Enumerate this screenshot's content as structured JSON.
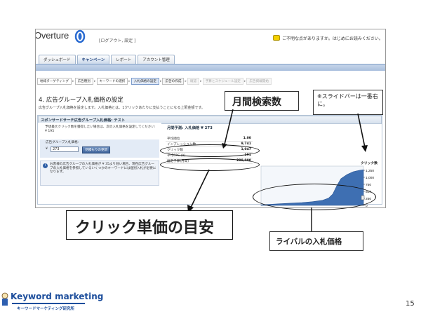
{
  "header": {
    "logo_text": "Overture",
    "sub_links": "[ログアウト, 設定 ]",
    "help_text": "ご不明な点がありますか。はじめにお読みください。"
  },
  "tabs": [
    {
      "label": "ダッシュボード",
      "active": false
    },
    {
      "label": "キャンペーン",
      "active": true
    },
    {
      "label": "レポート",
      "active": false
    },
    {
      "label": "アカウント管理",
      "active": false
    }
  ],
  "steps": [
    {
      "label": "地域ターゲティング",
      "state": "done"
    },
    {
      "label": "広告種別",
      "state": "done"
    },
    {
      "label": "キーワードの選択",
      "state": "done"
    },
    {
      "label": "入札価格の設定",
      "state": "current"
    },
    {
      "label": "広告の作成",
      "state": "todo"
    },
    {
      "label": "確認",
      "state": "dim"
    },
    {
      "label": "予算とスケジュール設定",
      "state": "dim"
    },
    {
      "label": "広告掲載開始",
      "state": "dim"
    }
  ],
  "section": {
    "title": "4. 広告グループ入札価格の設定",
    "description": "広告グループ入札価格を設定します。入札価格とは、1クリックあたりに支払うことになる上限金額です。"
  },
  "panel": {
    "header": "スポンサードサーチ広告グループ入札価格: テスト",
    "recommend_text": "予想最大クリック数を獲得したい場合は、次の入札価格を設定してください: ¥ 195",
    "bid_label": "広告グループ入札価格:",
    "bid_currency": "¥",
    "bid_value": "273",
    "update_button": "見積もりの更新",
    "info_text": "お客様の広告グループの入札価格が ¥ 35より低い場合、現在広告グループの入札価格を参照しているいくつかのキーワードには個別入札が必要になります。"
  },
  "estimate": {
    "heading": "月間予測: 入札価格 ¥ 273",
    "rows": [
      {
        "label": "平均順位",
        "value": "1.00"
      },
      {
        "label": "インプレッション数",
        "value": "9,741"
      },
      {
        "label": "クリック数",
        "value": "1,047"
      },
      {
        "label": "平均CPC (¥)",
        "value": "191"
      },
      {
        "label": "推定予算(月間)",
        "value": "200,000"
      }
    ]
  },
  "chart_data": {
    "type": "area",
    "title": "",
    "xlabel": "入札価格",
    "ylabel": "クリック数",
    "x_ticks": [
      50,
      100,
      150,
      200,
      250
    ],
    "y_ticks": [
      0,
      250,
      500,
      750,
      1000,
      1250
    ],
    "y_tick_labels": [
      "0",
      "250",
      "500",
      "750",
      "1,000",
      "1,250"
    ],
    "xlim": [
      25,
      275
    ],
    "ylim": [
      0,
      1400
    ],
    "x": [
      25,
      50,
      75,
      100,
      125,
      150,
      175,
      190,
      200,
      210,
      220,
      235,
      250,
      265,
      275
    ],
    "y": [
      20,
      40,
      60,
      80,
      100,
      130,
      180,
      260,
      400,
      700,
      950,
      1100,
      1200,
      1250,
      1270
    ],
    "color": "#3e6fb2"
  },
  "callouts": {
    "monthly_search": "月間検索数",
    "slider_note": "※スライドバーは一番右に。",
    "cpc_guide": "クリック単価の目安",
    "rival_bid": "ライバルの入札価格"
  },
  "footer": {
    "brand_title": "Keyword marketing",
    "brand_sub": "キーワードマーケティング研究所",
    "page_number": "15"
  },
  "colors": {
    "accent_blue": "#3e6fb2",
    "brand_blue": "#1d4e9c"
  }
}
